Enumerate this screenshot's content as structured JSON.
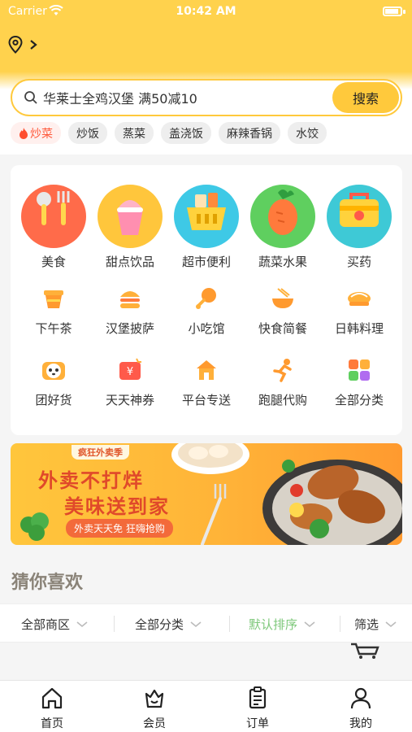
{
  "status_bar": {
    "carrier": "Carrier",
    "time": "10:42 AM"
  },
  "search": {
    "value": "华莱士全鸡汉堡 满50减10",
    "button": "搜索"
  },
  "hot_tags": [
    "炒菜",
    "炒饭",
    "蒸菜",
    "盖浇饭",
    "麻辣香锅",
    "水饺"
  ],
  "big_categories": [
    {
      "label": "美食",
      "icon": "tableware-icon",
      "color": "#ff6b4a"
    },
    {
      "label": "甜点饮品",
      "icon": "ice-cream-icon",
      "color": "#ffc63c"
    },
    {
      "label": "超市便利",
      "icon": "shopping-basket-icon",
      "color": "#3ec9e6"
    },
    {
      "label": "蔬菜水果",
      "icon": "carrot-icon",
      "color": "#5fcf5f"
    },
    {
      "label": "买药",
      "icon": "medicine-kit-icon",
      "color": "#3ec9d6"
    }
  ],
  "small_categories_row1": [
    {
      "label": "下午茶",
      "icon": "tea-cup-icon"
    },
    {
      "label": "汉堡披萨",
      "icon": "burger-icon"
    },
    {
      "label": "小吃馆",
      "icon": "drumstick-icon"
    },
    {
      "label": "快食简餐",
      "icon": "bowl-icon"
    },
    {
      "label": "日韩料理",
      "icon": "sushi-icon"
    }
  ],
  "small_categories_row2": [
    {
      "label": "团好货",
      "icon": "panda-icon"
    },
    {
      "label": "天天神券",
      "icon": "coupon-icon"
    },
    {
      "label": "平台专送",
      "icon": "shop-icon"
    },
    {
      "label": "跑腿代购",
      "icon": "runner-icon"
    },
    {
      "label": "全部分类",
      "icon": "grid-icon"
    }
  ],
  "banner": {
    "badge": "疯狂外卖季",
    "line1": "外卖不打烊",
    "line2": "美味送到家",
    "pill": "外卖天天免 狂嗨抢购"
  },
  "section_title": "猜你喜欢",
  "filters": [
    "全部商区",
    "全部分类",
    "默认排序",
    "筛选"
  ],
  "active_filter": "默认排序",
  "tabbar": [
    {
      "label": "首页",
      "icon": "home-icon"
    },
    {
      "label": "会员",
      "icon": "crown-basket-icon"
    },
    {
      "label": "订单",
      "icon": "clipboard-icon"
    },
    {
      "label": "我的",
      "icon": "user-icon"
    }
  ],
  "colors": {
    "brand": "#ffc93c",
    "header": "#ffd24d",
    "active": "#7dc87a",
    "hot": "#ff5a3c"
  }
}
